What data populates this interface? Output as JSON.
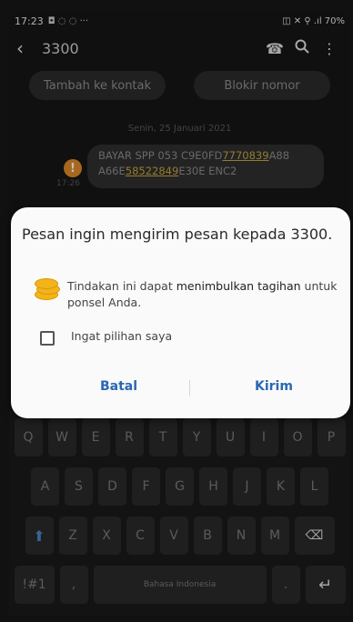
{
  "status": {
    "time": "17:23",
    "icons": "◘ ◌ ◌ ···",
    "right": "◫ ✕ ⚲ .ıl 70%"
  },
  "header": {
    "back_icon": "‹",
    "title": "3300",
    "call_icon": "☎",
    "search_icon": "🔍",
    "menu_icon": "⋮"
  },
  "actions": {
    "add_contact": "Tambah ke kontak",
    "block_number": "Blokir nomor"
  },
  "date_separator": "Senin, 25 Januari 2021",
  "message": {
    "time": "17:26",
    "warning_icon": "!",
    "line1_a": "BAYAR SPP 053 C9E0FD",
    "line1_link": "7770839",
    "line1_b": "A88",
    "line2_a": "A66E",
    "line2_link": "58522849",
    "line2_b": "E30E ENC2"
  },
  "dialog": {
    "title": "Pesan ingin mengirim pesan kepada 3300.",
    "body_a": "Tindakan ini dapat ",
    "body_bold": "menimbulkan tagihan",
    "body_b": " untuk ponsel Anda.",
    "remember_label": "Ingat pilihan saya",
    "remember_checked": false,
    "cancel_label": "Batal",
    "send_label": "Kirim"
  },
  "keyboard": {
    "row1": [
      "Q",
      "W",
      "E",
      "R",
      "T",
      "Y",
      "U",
      "I",
      "O",
      "P"
    ],
    "row2": [
      "A",
      "S",
      "D",
      "F",
      "G",
      "H",
      "J",
      "K",
      "L"
    ],
    "row3": [
      "Z",
      "X",
      "C",
      "V",
      "B",
      "N",
      "M"
    ],
    "symbols": "!#1",
    "comma": ",",
    "space": "Bahasa Indonesia",
    "period": ".",
    "shift_icon": "⬆",
    "backspace_icon": "⌫",
    "enter_icon": "↵"
  }
}
